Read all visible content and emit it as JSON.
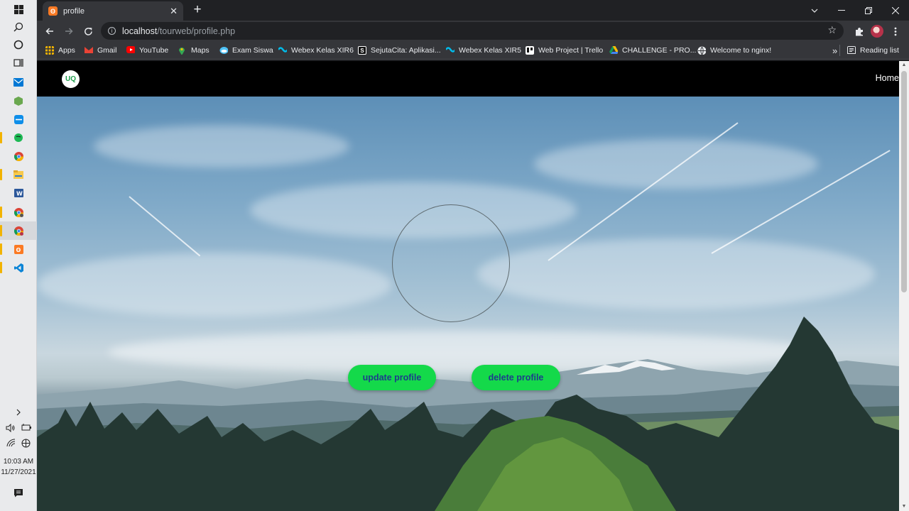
{
  "taskbar": {
    "icons": [
      "windows-start-icon",
      "search-icon",
      "cortana-icon",
      "task-view-icon",
      "mail-icon",
      "app-green-icon",
      "teamviewer-icon",
      "spotify-icon",
      "chrome-icon",
      "file-explorer-icon",
      "word-icon",
      "chrome-icon",
      "chrome-icon",
      "xampp-icon",
      "vscode-icon"
    ],
    "time": "10:03 AM",
    "date": "11/27/2021"
  },
  "browser": {
    "tab_title": "profile",
    "url_host": "localhost",
    "url_path": "/tourweb/profile.php",
    "bookmarks": [
      {
        "label": "Apps",
        "icon": "apps-grid-icon",
        "color": "#f4b400"
      },
      {
        "label": "Gmail",
        "icon": "gmail-icon",
        "color": "#ea4335"
      },
      {
        "label": "YouTube",
        "icon": "youtube-icon",
        "color": "#ff0000"
      },
      {
        "label": "Maps",
        "icon": "maps-icon",
        "color": "#34a853"
      },
      {
        "label": "Exam Siswa",
        "icon": "exam-icon",
        "color": "#4fc3f7"
      },
      {
        "label": "Webex Kelas XIR6",
        "icon": "webex-icon",
        "color": "#00bceb"
      },
      {
        "label": "SejutaCita: Aplikasi...",
        "icon": "sejutacita-icon",
        "color": "#111111"
      },
      {
        "label": "Webex Kelas XIR5",
        "icon": "webex-icon",
        "color": "#00bceb"
      },
      {
        "label": "Web Project | Trello",
        "icon": "trello-icon",
        "color": "#ffffff"
      },
      {
        "label": "CHALLENGE - PRO...",
        "icon": "drive-icon",
        "color": "#fbbc04"
      },
      {
        "label": "Welcome to nginx!",
        "icon": "globe-icon",
        "color": "#e8eaed"
      }
    ],
    "more": "»",
    "reading_list": "Reading list"
  },
  "page": {
    "logo_text": "UQ",
    "nav_home": "Home",
    "update_button": "update profile",
    "delete_button": "delete profile"
  },
  "colors": {
    "button_bg": "#14d94a",
    "button_text": "#1d3c8c",
    "navbar_bg": "#000000"
  }
}
